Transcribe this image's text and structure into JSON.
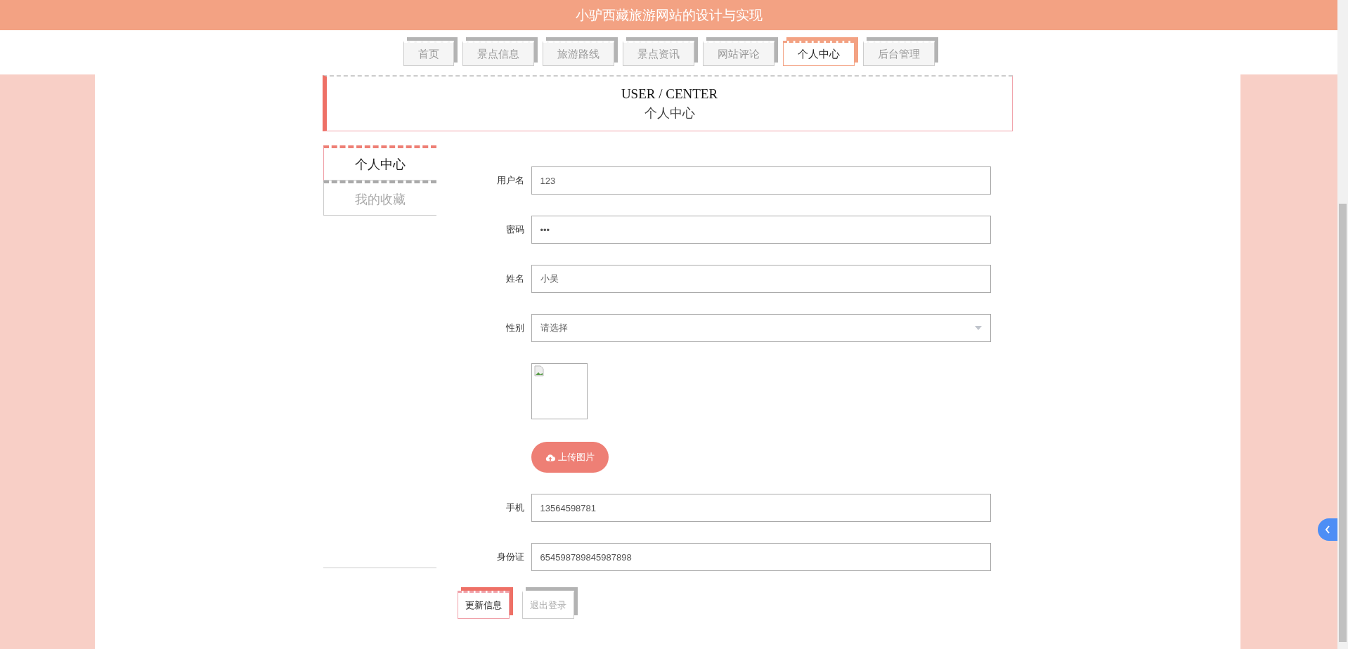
{
  "header": {
    "title": "小驴西藏旅游网站的设计与实现"
  },
  "nav_tabs": [
    {
      "label": "首页",
      "selected": false
    },
    {
      "label": "景点信息",
      "selected": false
    },
    {
      "label": "旅游路线",
      "selected": false
    },
    {
      "label": "景点资讯",
      "selected": false
    },
    {
      "label": "网站评论",
      "selected": false
    },
    {
      "label": "个人中心",
      "selected": true
    },
    {
      "label": "后台管理",
      "selected": false
    }
  ],
  "section_title": {
    "english": "USER / CENTER",
    "chinese": "个人中心"
  },
  "sidebar": {
    "items": [
      {
        "label": "个人中心",
        "selected": true
      },
      {
        "label": "我的收藏",
        "selected": false
      }
    ]
  },
  "form": {
    "fields": [
      {
        "kind": "text",
        "label": "用户名",
        "value": "123"
      },
      {
        "kind": "text",
        "label": "密码",
        "value": "•••"
      },
      {
        "kind": "text",
        "label": "姓名",
        "value": "小吴"
      },
      {
        "kind": "select",
        "label": "性别",
        "placeholder": "请选择"
      },
      {
        "kind": "image",
        "button": "上传图片"
      },
      {
        "kind": "text",
        "label": "手机",
        "value": "13564598781"
      },
      {
        "kind": "text",
        "label": "身份证",
        "value": "654598789845987898"
      }
    ],
    "buttons": [
      {
        "label": "更新信息",
        "kind": "primary"
      },
      {
        "label": "退出登录",
        "kind": "secondary"
      }
    ]
  }
}
